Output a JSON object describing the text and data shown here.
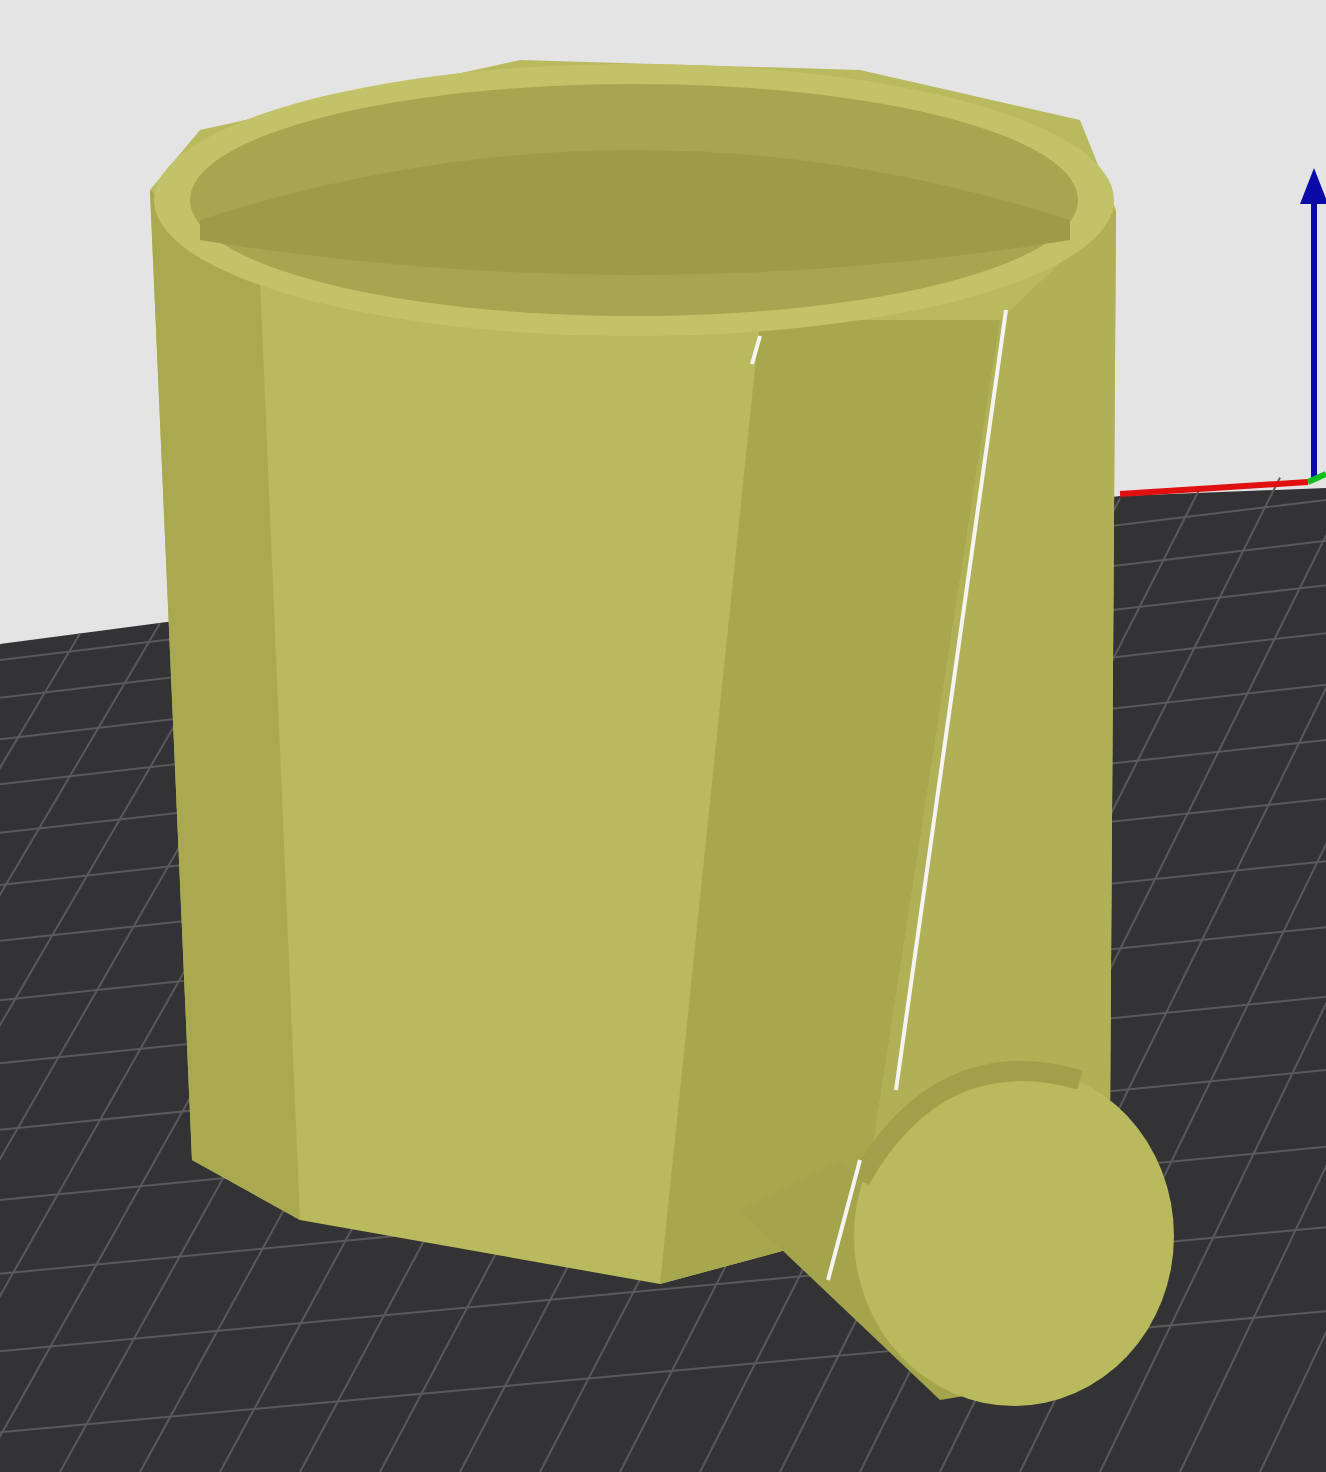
{
  "viewport": {
    "axes": [
      {
        "kind": "z",
        "color": "#0a0aa8"
      },
      {
        "kind": "x",
        "color": "#e01010"
      },
      {
        "kind": "y",
        "color": "#10c020"
      }
    ]
  }
}
